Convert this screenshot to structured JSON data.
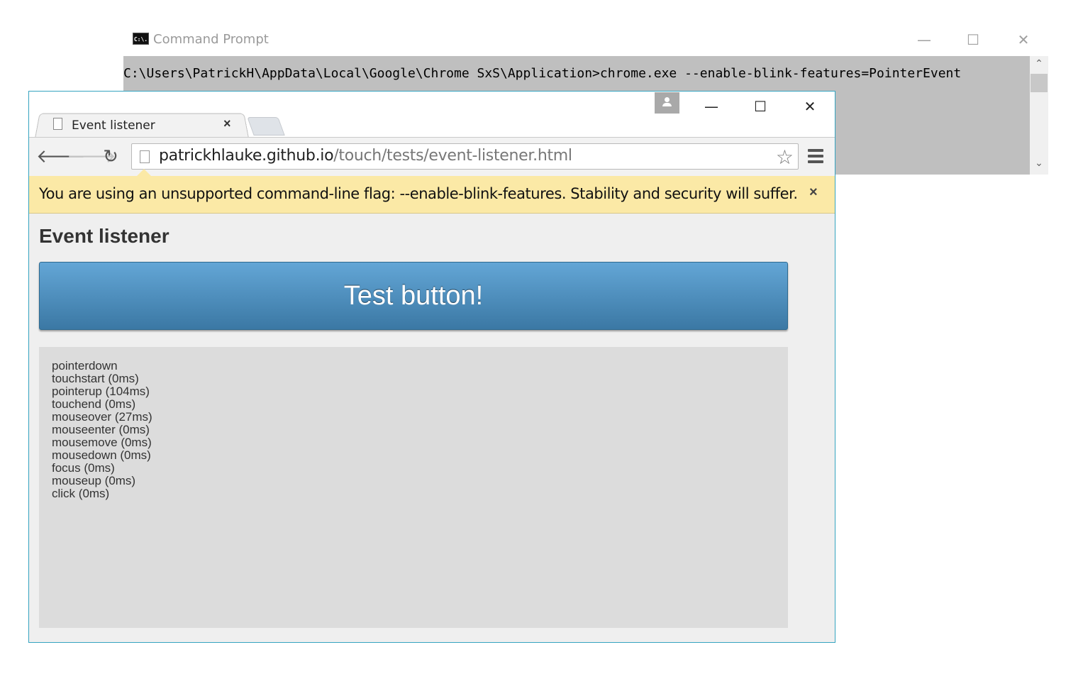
{
  "cmd": {
    "title": "Command Prompt",
    "icon": "cmd-icon",
    "icon_text": "C:\\.",
    "controls": {
      "minimize": "—",
      "maximize": "☐",
      "close": "✕"
    },
    "scroll_up": "⌃",
    "scroll_down": "⌄",
    "line": "C:\\Users\\PatrickH\\AppData\\Local\\Google\\Chrome SxS\\Application>chrome.exe --enable-blink-features=PointerEvent"
  },
  "browser": {
    "window_controls": {
      "minimize": "—",
      "maximize": "☐",
      "close": "✕"
    },
    "tab": {
      "title": "Event listener",
      "close": "×"
    },
    "nav": {
      "back": "🡐",
      "forward": "🡒",
      "reload": "↻"
    },
    "url": {
      "host": "patrickhlauke.github.io",
      "path": "/touch/tests/event-listener.html"
    },
    "star": "☆",
    "infobar": {
      "text": "You are using an unsupported command-line flag: --enable-blink-features. Stability and security will suffer.",
      "close": "×"
    }
  },
  "page": {
    "title": "Event listener",
    "button_label": "Test button!",
    "log": [
      "pointerdown",
      "touchstart (0ms)",
      "pointerup (104ms)",
      "touchend (0ms)",
      "mouseover (27ms)",
      "mouseenter (0ms)",
      "mousemove (0ms)",
      "mousedown (0ms)",
      "focus (0ms)",
      "mouseup (0ms)",
      "click (0ms)"
    ]
  },
  "colors": {
    "infobar": "#fbe9a6",
    "button_top": "#63a6d6",
    "button_bottom": "#3b78a4",
    "window_border": "#35a4c0",
    "cmd_background": "#bfbfbf"
  }
}
